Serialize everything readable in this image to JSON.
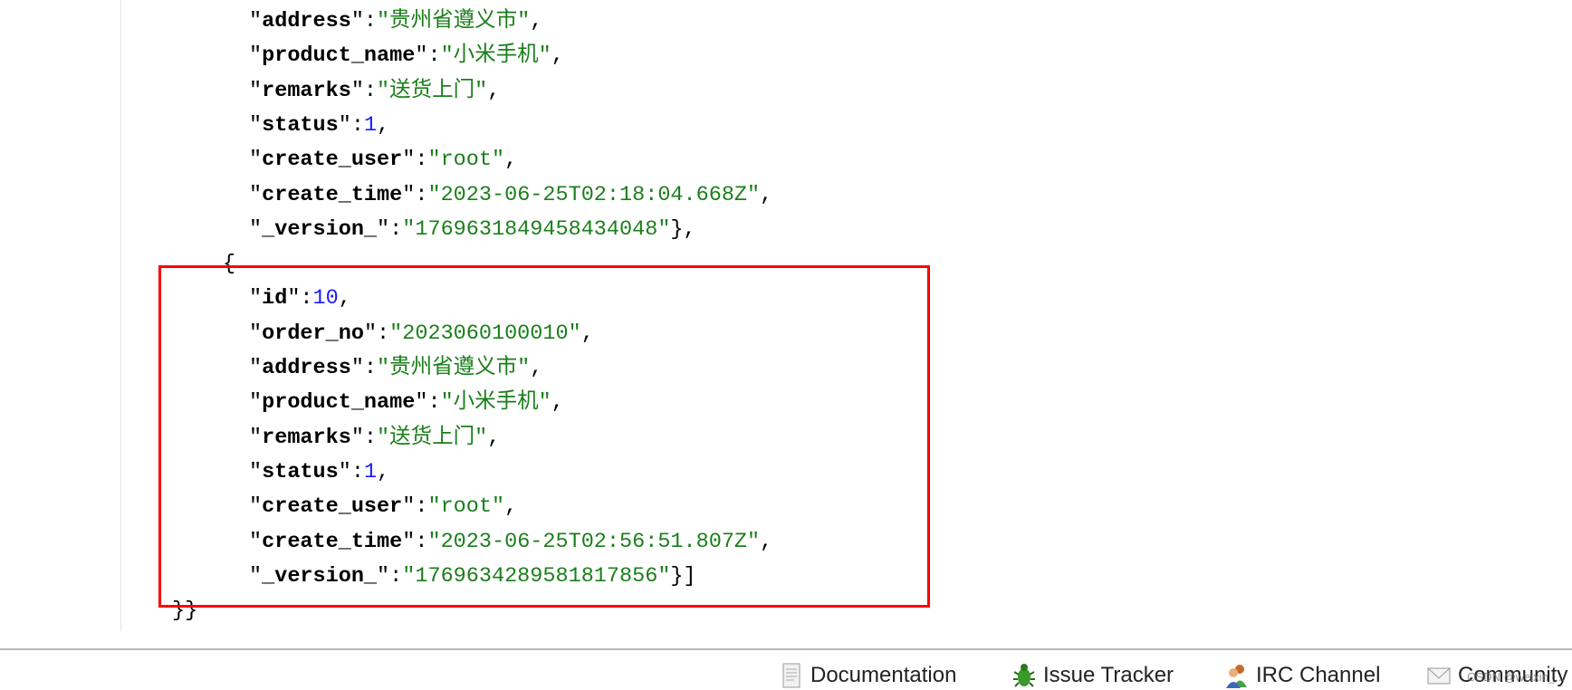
{
  "records": [
    {
      "partial": true,
      "address": "贵州省遵义市",
      "product_name": "小米手机",
      "remarks": "送货上门",
      "status": 1,
      "create_user": "root",
      "create_time": "2023-06-25T02:18:04.668Z",
      "_version_": "1769631849458434048"
    },
    {
      "id": 10,
      "order_no": "2023060100010",
      "address": "贵州省遵义市",
      "product_name": "小米手机",
      "remarks": "送货上门",
      "status": 1,
      "create_user": "root",
      "create_time": "2023-06-25T02:56:51.807Z",
      "_version_": "1769634289581817856"
    }
  ],
  "highlight_color": "#ff0000",
  "footer": {
    "links": [
      {
        "label": "Documentation",
        "icon": "document-icon"
      },
      {
        "label": "Issue Tracker",
        "icon": "bug-icon"
      },
      {
        "label": "IRC Channel",
        "icon": "people-icon"
      },
      {
        "label": "Community",
        "icon": "envelope-icon"
      }
    ]
  },
  "watermark": "CSDN @weixin_..."
}
